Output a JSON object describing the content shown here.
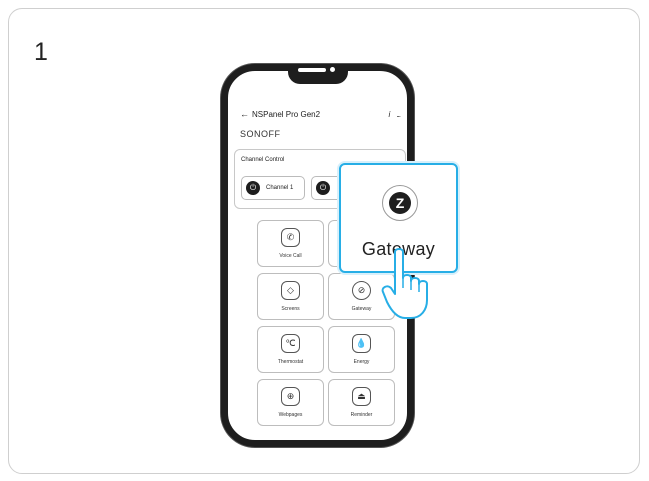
{
  "step_number": "1",
  "topbar": {
    "back_icon": "←",
    "title": "NSPanel Pro Gen2",
    "info_icon": "i",
    "more_icon": "..."
  },
  "brand": "SONOFF",
  "channel_control": {
    "title": "Channel Control",
    "channels": [
      {
        "label": "Channel 1"
      },
      {
        "label": ""
      }
    ]
  },
  "tiles": [
    {
      "label": "Voice Call",
      "icon": "phone-icon"
    },
    {
      "label": "",
      "icon": "partial-icon"
    },
    {
      "label": "Screens",
      "icon": "layers-icon"
    },
    {
      "label": "Gateway",
      "icon": "zigbee-icon"
    },
    {
      "label": "Thermostat",
      "icon": "thermostat-icon"
    },
    {
      "label": "Energy",
      "icon": "energy-icon"
    },
    {
      "label": "Webpages",
      "icon": "webpages-icon"
    },
    {
      "label": "Reminder",
      "icon": "reminder-icon"
    }
  ],
  "callout": {
    "label": "Gateway",
    "icon": "zigbee-icon"
  },
  "colors": {
    "accent": "#27aee6",
    "dark": "#1e1e1e",
    "border": "#bdbdbd"
  }
}
